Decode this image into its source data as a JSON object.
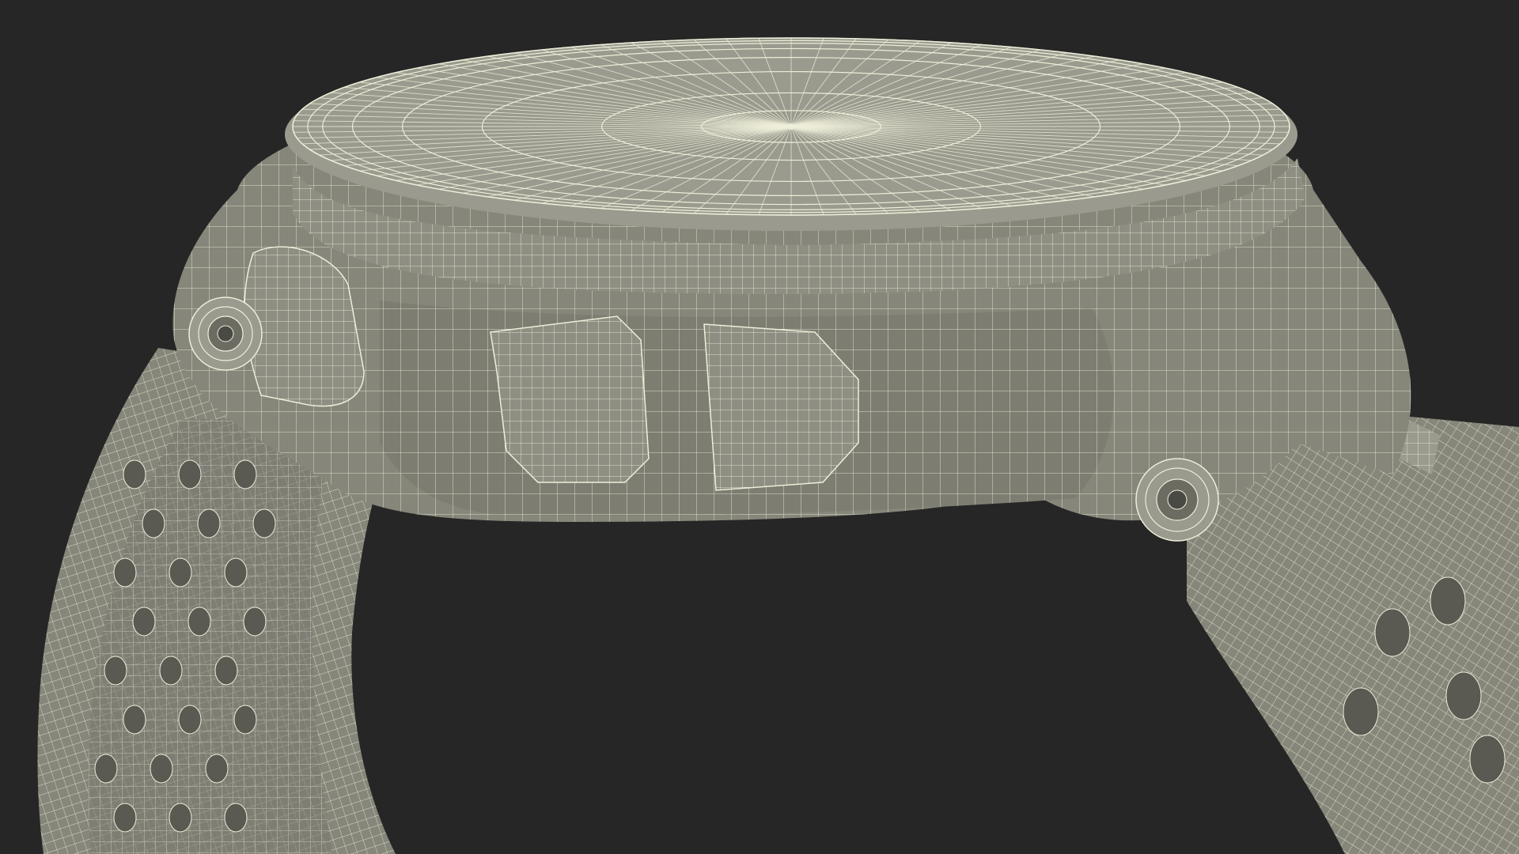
{
  "scene": {
    "subject": "watch-wireframe",
    "colors": {
      "background": "#262626",
      "surface": "#86867a",
      "surface_light": "#9a9a8e",
      "surface_dark": "#6c6c62",
      "wire": "#eeeeda"
    }
  }
}
